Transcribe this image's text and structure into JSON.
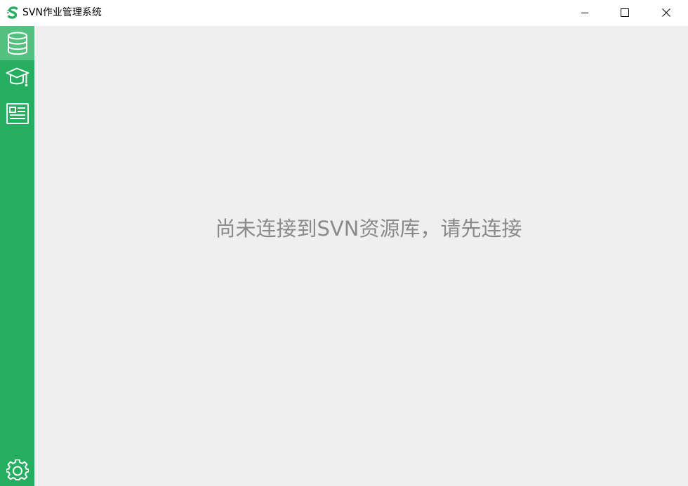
{
  "window": {
    "title": "SVN作业管理系统",
    "icon": "svn-logo-icon",
    "controls": [
      "minimize-icon",
      "maximize-icon",
      "close-icon"
    ]
  },
  "sidebar": {
    "background": "#26ae60",
    "active_background": "#55c180",
    "items": [
      {
        "icon": "database-icon",
        "active": true
      },
      {
        "icon": "graduation-cap-icon",
        "active": false
      },
      {
        "icon": "document-icon",
        "active": false
      }
    ],
    "footer_icon": "gear-icon"
  },
  "main": {
    "background": "#efefef",
    "message": "尚未连接到SVN资源库，请先连接",
    "message_color": "#8a8a8a"
  }
}
